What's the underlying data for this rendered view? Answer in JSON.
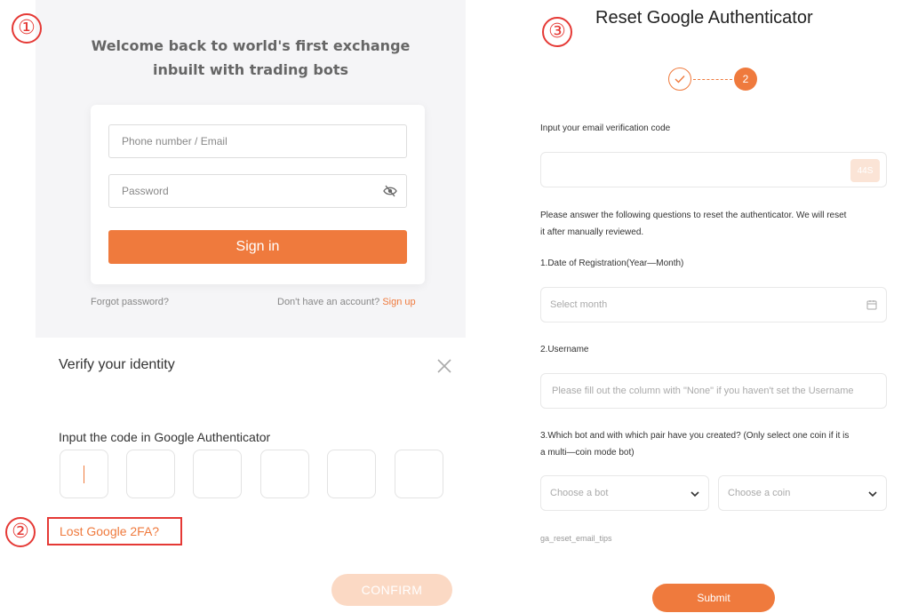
{
  "markers": {
    "one": "①",
    "two": "②",
    "three": "③"
  },
  "login": {
    "welcome_line1": "Welcome back to world's first exchange",
    "welcome_line2": "inbuilt with trading bots",
    "phone_placeholder": "Phone number / Email",
    "password_placeholder": "Password",
    "signin_label": "Sign in",
    "forgot": "Forgot password?",
    "no_account": "Don't have an account?",
    "signup": "Sign up"
  },
  "verify": {
    "title": "Verify your identity",
    "code_label": "Input the code in Google Authenticator",
    "lost": "Lost Google 2FA?",
    "confirm": "CONFIRM"
  },
  "reset": {
    "title": "Reset Google Authenticator",
    "step_current": "2",
    "email_label": "Input your email verification code",
    "countdown": "44S",
    "answer_line1": "Please answer the following questions to reset the authenticator. We will reset",
    "answer_line2": "it after manually reviewed.",
    "q1": "1.Date of Registration(Year—Month)",
    "q1_placeholder": "Select month",
    "q2": "2.Username",
    "q2_placeholder": "Please fill out the column with \"None\" if you haven't set the Username",
    "q3_line1": "3.Which bot and with which pair have you created?  (Only select one coin if it is",
    "q3_line2": "a multi—coin mode bot)",
    "bot_placeholder": "Choose a bot",
    "coin_placeholder": "Choose a coin",
    "tips": "ga_reset_email_tips",
    "submit": "Submit"
  },
  "colors": {
    "accent": "#ef7a3d",
    "annotation": "#e53935",
    "panel_bg": "#f5f5f7"
  },
  "icons": [
    "eye-slash-icon",
    "close-icon",
    "checkmark-icon",
    "calendar-icon",
    "chevron-down-icon"
  ]
}
